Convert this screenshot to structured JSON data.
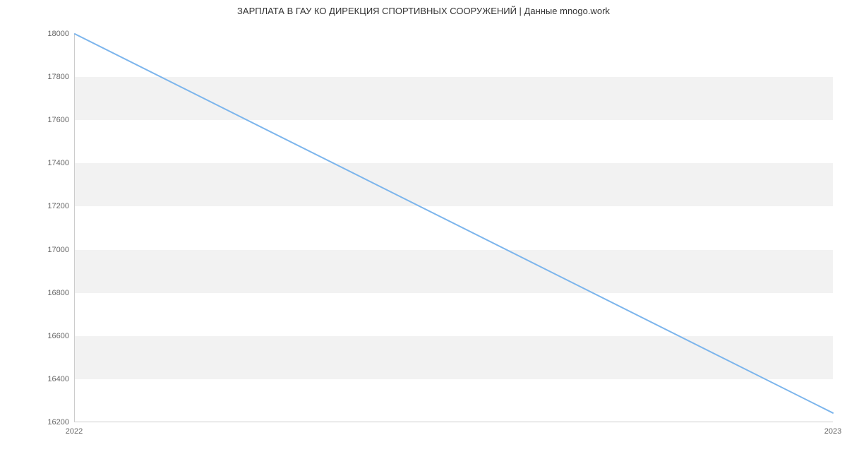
{
  "chart_data": {
    "type": "line",
    "title": "ЗАРПЛАТА В ГАУ КО ДИРЕКЦИЯ СПОРТИВНЫХ СООРУЖЕНИЙ | Данные mnogo.work",
    "xlabel": "",
    "ylabel": "",
    "x": [
      2022,
      2023
    ],
    "values": [
      18000,
      16240
    ],
    "x_ticks": [
      2022,
      2023
    ],
    "y_ticks": [
      16200,
      16400,
      16600,
      16800,
      17000,
      17200,
      17400,
      17600,
      17800,
      18000
    ],
    "xlim": [
      2022,
      2023
    ],
    "ylim": [
      16200,
      18000
    ],
    "line_color": "#7cb5ec",
    "band_color": "#f2f2f2",
    "grid": true
  }
}
